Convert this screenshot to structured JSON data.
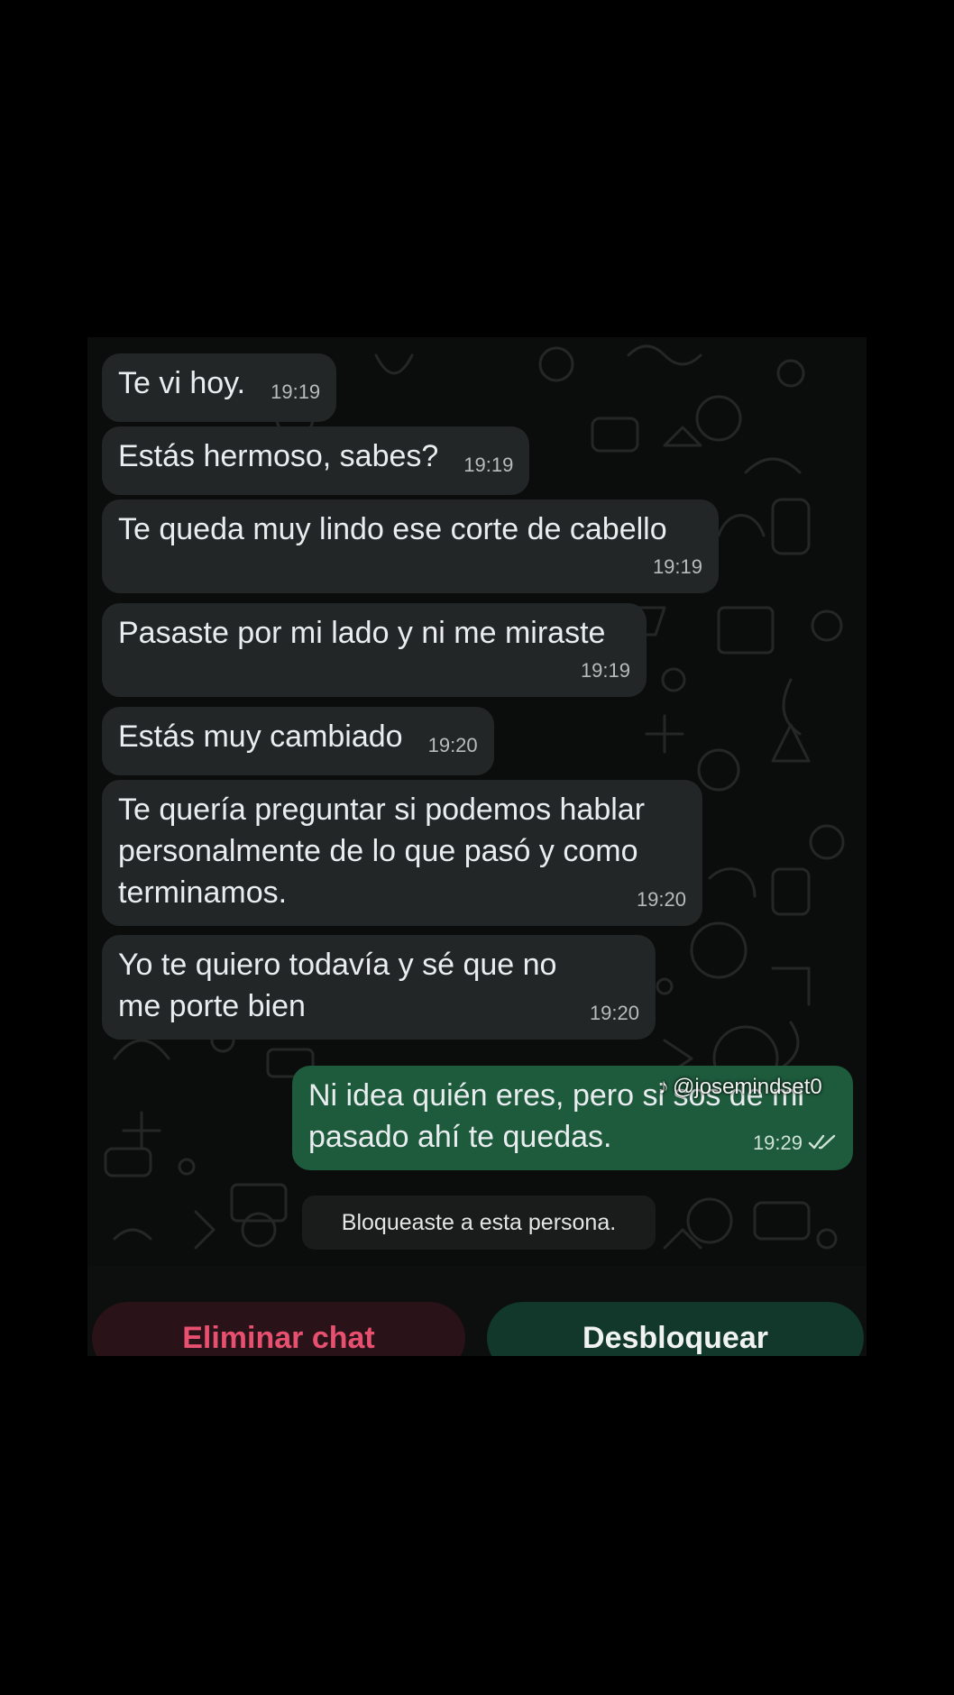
{
  "messages": [
    {
      "text": "Te vi hoy.",
      "time": "19:19"
    },
    {
      "text": "Estás hermoso, sabes?",
      "time": "19:19"
    },
    {
      "text": "Te queda muy lindo ese corte de cabello",
      "time": "19:19"
    },
    {
      "text": "Pasaste por mi lado y ni me miraste",
      "time": "19:19"
    },
    {
      "text": "Estás muy cambiado",
      "time": "19:20"
    },
    {
      "text": "Te quería preguntar si podemos hablar personalmente de lo que pasó y como terminamos.",
      "time": "19:20"
    },
    {
      "text": "Yo te quiero todavía y sé que no me porte bien",
      "time": "19:20"
    }
  ],
  "reply": {
    "text": "Ni idea quién eres, pero si sos de mi pasado ahí te quedas.",
    "time": "19:29",
    "status_icon": "double-check-icon"
  },
  "watermark": {
    "text": "@josemindset0",
    "icon": "tiktok-icon"
  },
  "system_notice": "Bloqueaste a esta persona.",
  "actions": {
    "delete_label": "Eliminar chat",
    "unblock_label": "Desbloquear"
  },
  "colors": {
    "incoming_bubble": "#232626",
    "outgoing_bubble": "#1d5b3c",
    "delete_text": "#e8506f",
    "unblock_button": "#11382a"
  }
}
